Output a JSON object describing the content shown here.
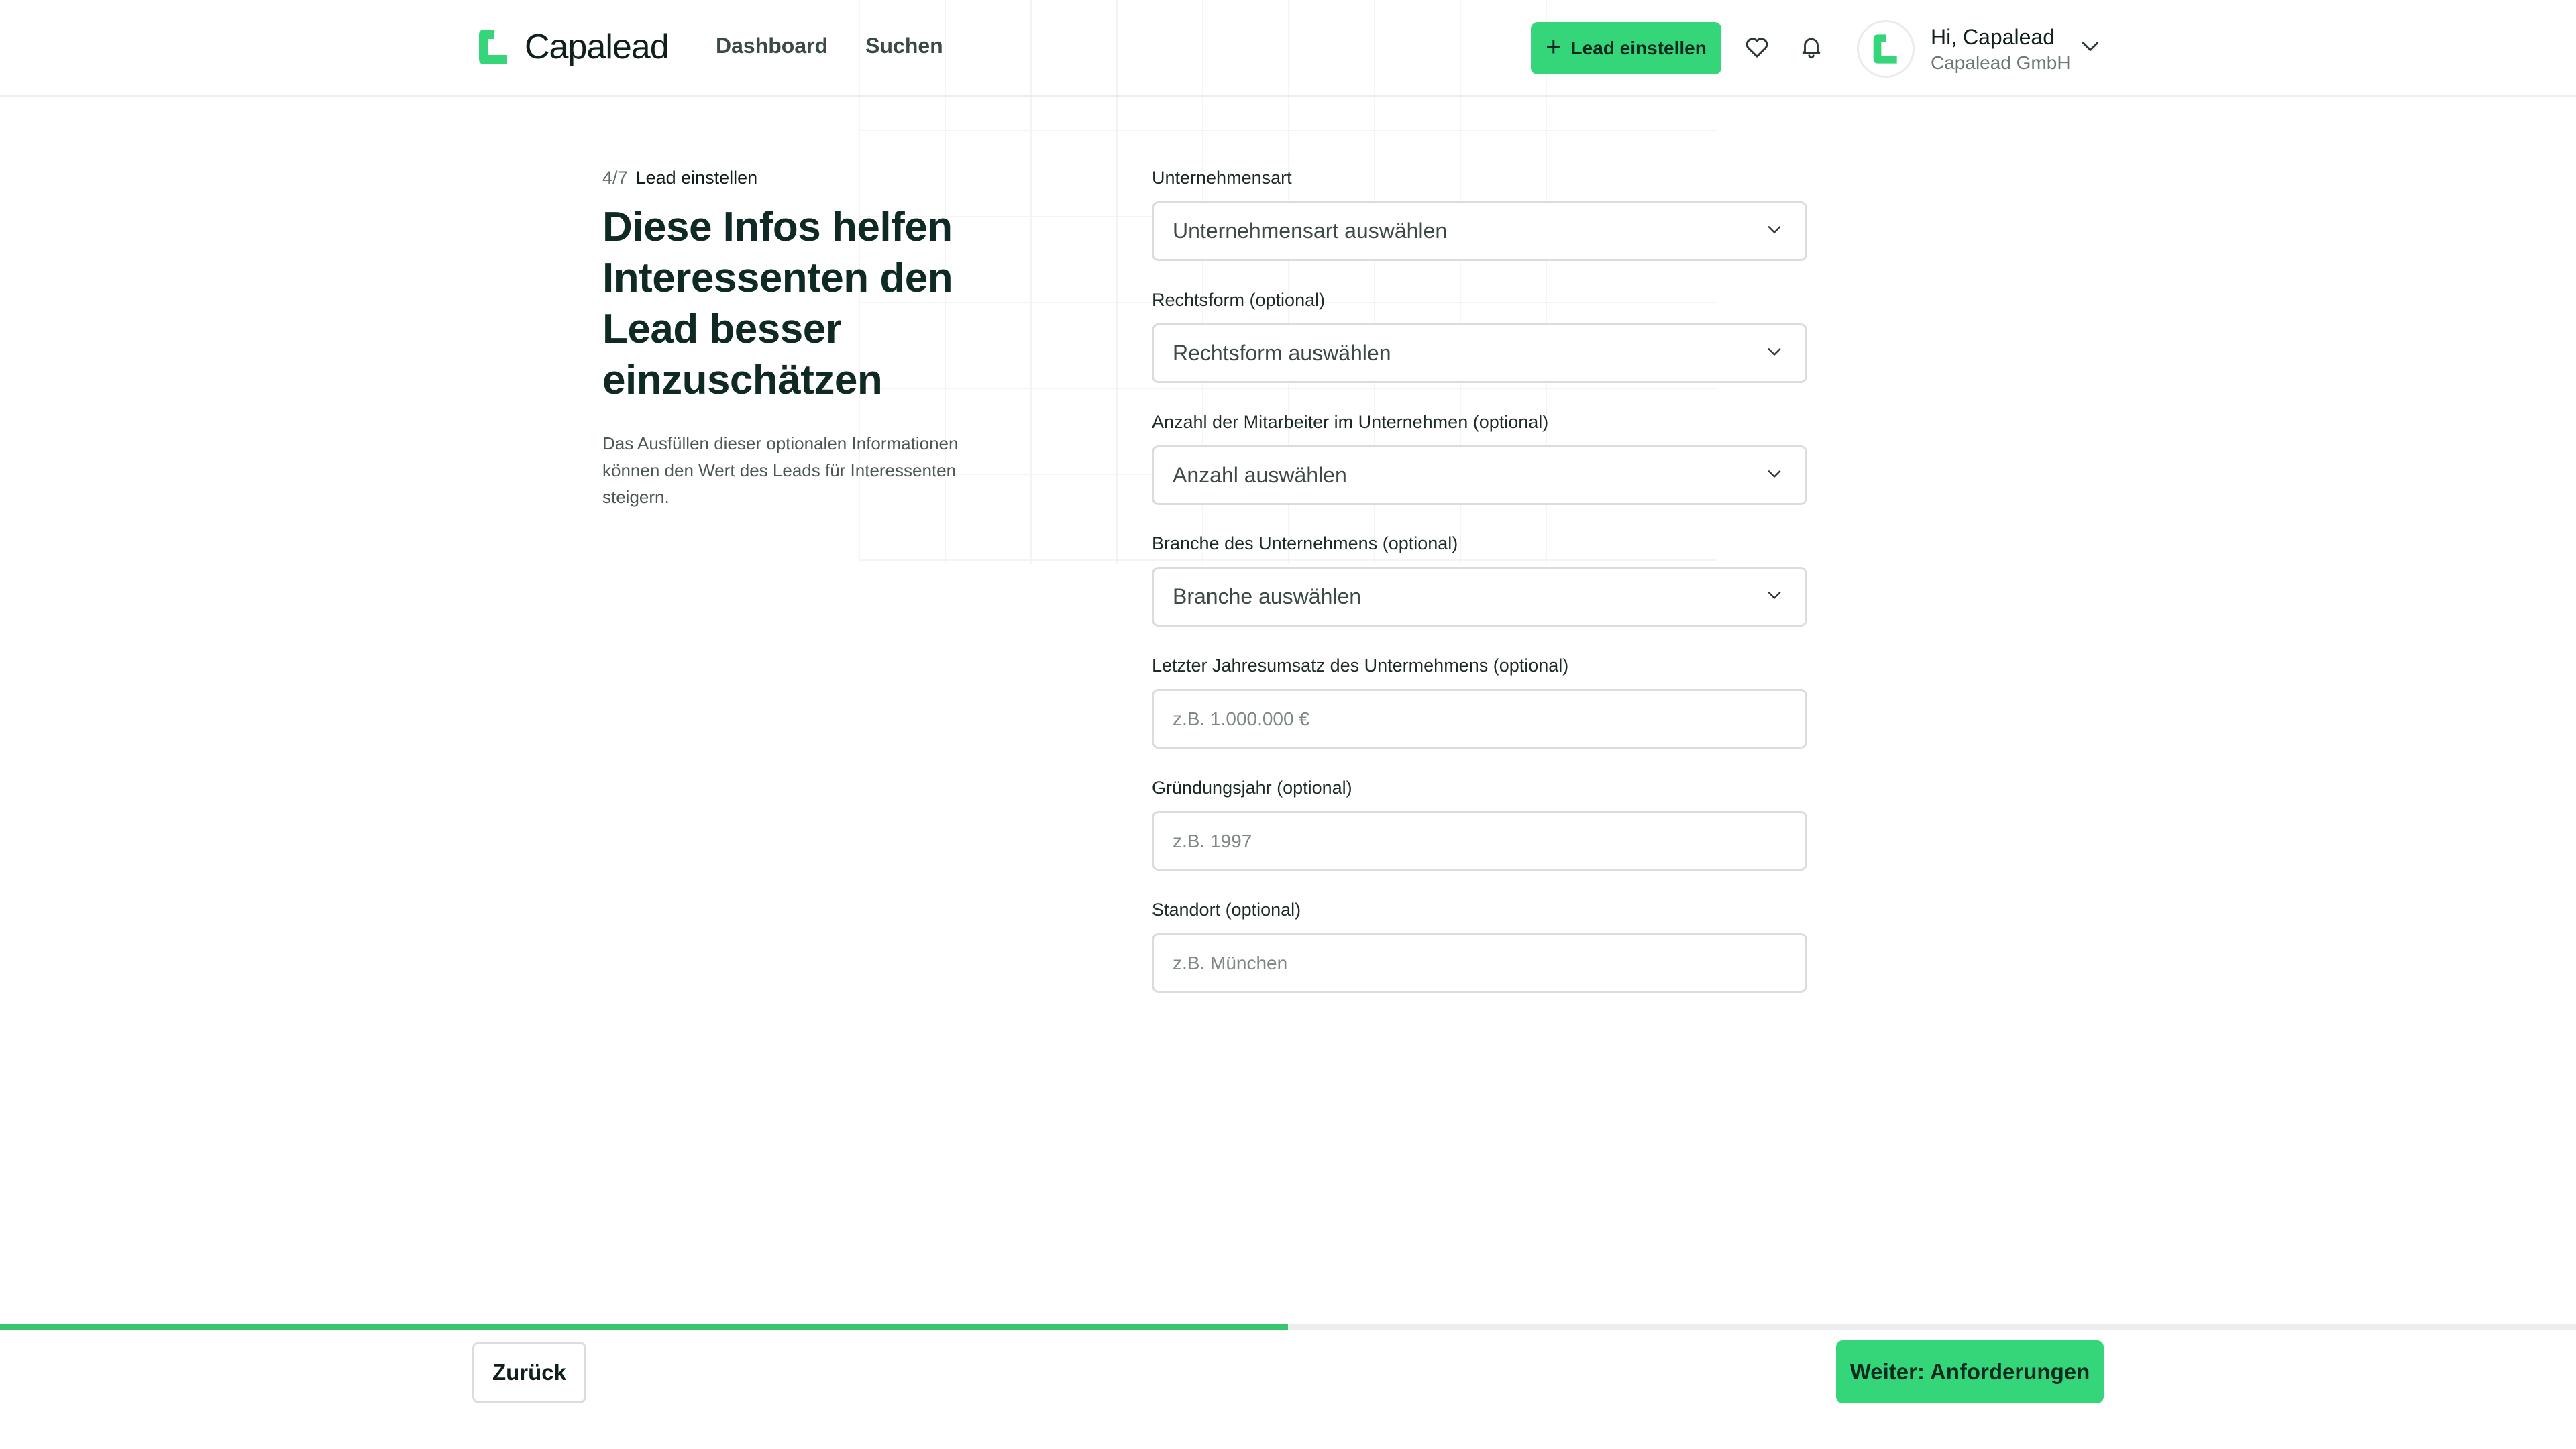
{
  "brand": {
    "name": "Capalead",
    "accent": "#35d57a"
  },
  "nav": {
    "items": [
      "Dashboard",
      "Suchen"
    ]
  },
  "header": {
    "cta_label": "Lead einstellen",
    "user_greeting": "Hi, Capalead",
    "user_company": "Capalead GmbH",
    "icons": [
      "heart-icon",
      "bell-icon",
      "chevron-down-icon"
    ]
  },
  "intro": {
    "step": "4/7",
    "step_label": "Lead einstellen",
    "headline": "Diese Infos helfen Interessenten den Lead besser einzuschätzen",
    "description": "Das Ausfüllen dieser optionalen Informationen können den Wert des Leads für Interessenten steigern."
  },
  "form": {
    "fields": [
      {
        "label": "Unternehmensart",
        "type": "select",
        "value": "Unternehmensart auswählen"
      },
      {
        "label": "Rechtsform (optional)",
        "type": "select",
        "value": "Rechtsform auswählen"
      },
      {
        "label": "Anzahl der Mitarbeiter im Unternehmen (optional)",
        "type": "select",
        "value": "Anzahl auswählen"
      },
      {
        "label": "Branche des Unternehmens (optional)",
        "type": "select",
        "value": "Branche auswählen"
      },
      {
        "label": "Letzter Jahresumsatz des Untermehmens (optional)",
        "type": "input",
        "placeholder": "z.B. 1.000.000 €"
      },
      {
        "label": "Gründungsjahr (optional)",
        "type": "input",
        "placeholder": "z.B. 1997"
      },
      {
        "label": "Standort (optional)",
        "type": "input",
        "placeholder": "z.B. München"
      }
    ]
  },
  "footer": {
    "progress_fraction": 0.5,
    "back_label": "Zurück",
    "next_label": "Weiter: Anforderungen"
  }
}
